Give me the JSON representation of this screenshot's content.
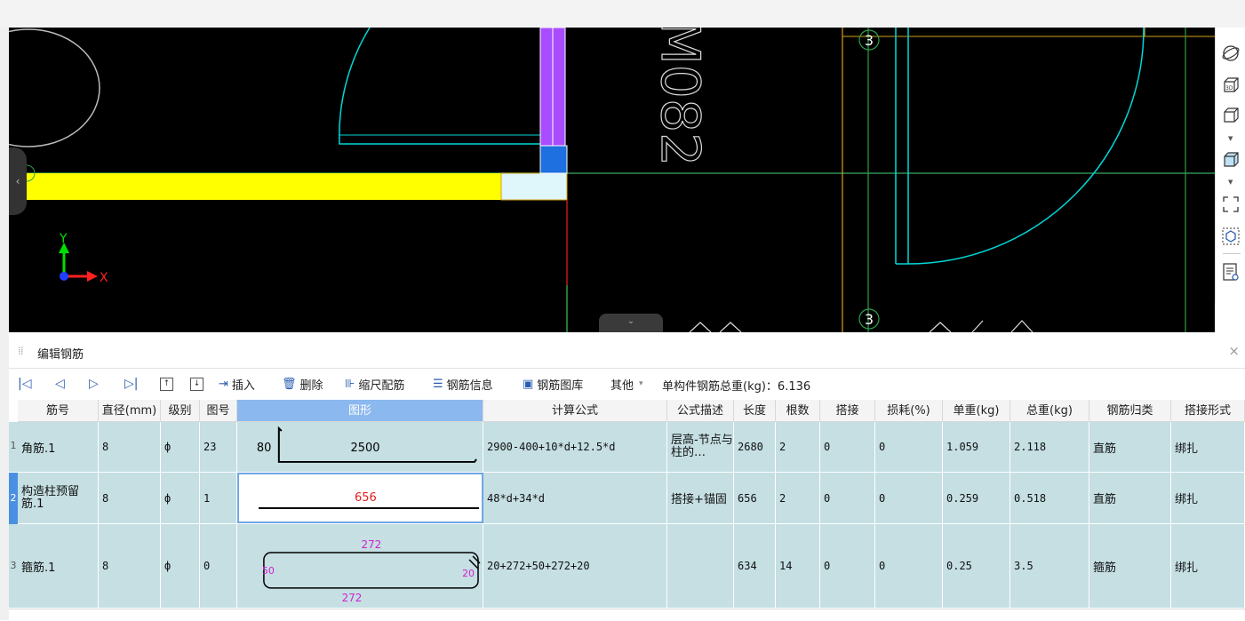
{
  "canvas": {
    "label_m": "M082",
    "axis_x": "X",
    "axis_y": "Y",
    "grid_label": "3",
    "colors": {
      "background": "#000000",
      "wall": "#ffff00",
      "column": "#1e6fe0",
      "door": "#00e5e5",
      "purple": "#a94cff"
    }
  },
  "right_toolbar": {
    "icons": [
      "orbit-icon",
      "view-3d-icon",
      "box-view-icon",
      "solid-view-icon",
      "fit-screen-icon",
      "component-view-icon",
      "layer-list-icon"
    ],
    "label_3d": "3D"
  },
  "panel": {
    "title": "编辑钢筋",
    "close": "×"
  },
  "toolbar": {
    "first": "|◁",
    "prev": "◁",
    "next": "▷",
    "last": "▷|",
    "up": "↑",
    "down": "↓",
    "insert": "插入",
    "delete": "删除",
    "scale": "缩尺配筋",
    "info": "钢筋信息",
    "library": "钢筋图库",
    "other": "其他",
    "total_label": "单构件钢筋总重(kg)：6.136"
  },
  "table": {
    "headers": [
      "筋号",
      "直径(mm)",
      "级别",
      "图号",
      "图形",
      "计算公式",
      "公式描述",
      "长度",
      "根数",
      "搭接",
      "损耗(%)",
      "单重(kg)",
      "总重(kg)",
      "钢筋归类",
      "搭接形式"
    ],
    "rows": [
      {
        "num": "1",
        "bar": "角筋.1",
        "diameter": "8",
        "grade": "ф",
        "shape_no": "23",
        "fig_a": "80",
        "fig_b": "2500",
        "formula": "2900-400+10*d+12.5*d",
        "desc": "层高-节点与柱的…",
        "length": "2680",
        "count": "2",
        "lap": "0",
        "loss": "0",
        "unit": "1.059",
        "total": "2.118",
        "category": "直筋",
        "lap_type": "绑扎"
      },
      {
        "num": "2",
        "bar": "构造柱预留筋.1",
        "diameter": "8",
        "grade": "ф",
        "shape_no": "1",
        "fig_a": "656",
        "formula": "48*d+34*d",
        "desc": "搭接+锚固",
        "length": "656",
        "count": "2",
        "lap": "0",
        "loss": "0",
        "unit": "0.259",
        "total": "0.518",
        "category": "直筋",
        "lap_type": "绑扎"
      },
      {
        "num": "3",
        "bar": "箍筋.1",
        "diameter": "8",
        "grade": "ф",
        "shape_no": "0",
        "fig_top": "272",
        "fig_bottom": "272",
        "fig_left": "50",
        "fig_right": "20",
        "formula": "20+272+50+272+20",
        "desc": "",
        "length": "634",
        "count": "14",
        "lap": "0",
        "loss": "0",
        "unit": "0.25",
        "total": "3.5",
        "category": "箍筋",
        "lap_type": "绑扎"
      }
    ]
  }
}
